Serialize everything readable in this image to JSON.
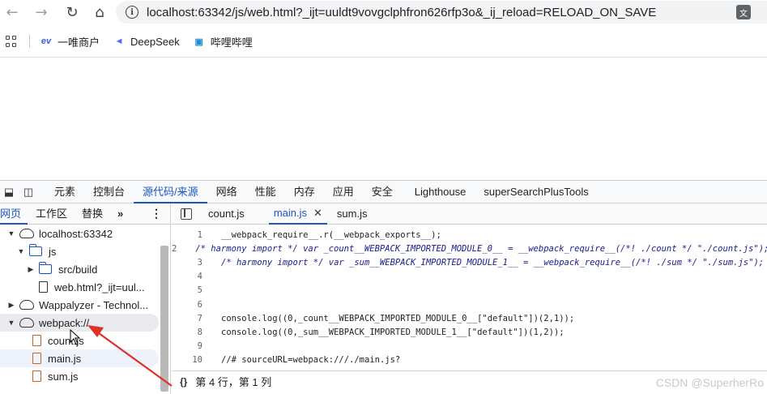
{
  "browser": {
    "url": "localhost:63342/js/web.html?_ijt=uuldt9vovgclphfron626rfp3o&_ij_reload=RELOAD_ON_SAVE",
    "bookmarks": [
      {
        "label": "一唯商户",
        "icon": "ev-logo-icon"
      },
      {
        "label": "DeepSeek",
        "icon": "deepseek-whale-icon"
      },
      {
        "label": "哔哩哔哩",
        "icon": "bilibili-tv-icon"
      }
    ]
  },
  "devtools": {
    "tabs": [
      "元素",
      "控制台",
      "源代码/来源",
      "网络",
      "性能",
      "内存",
      "应用",
      "安全",
      "Lighthouse",
      "superSearchPlusTools"
    ],
    "active_tab": "源代码/来源",
    "navigator": {
      "subtabs": [
        "网页",
        "工作区",
        "替换"
      ],
      "more": "»",
      "tree": [
        {
          "label": "localhost:63342",
          "type": "cloud",
          "caret": "▼",
          "depth": 0
        },
        {
          "label": "js",
          "type": "folder",
          "caret": "▼",
          "depth": 1
        },
        {
          "label": "src/build",
          "type": "folder",
          "caret": "▶",
          "depth": 2
        },
        {
          "label": "web.html?_ijt=uul...",
          "type": "file",
          "caret": "",
          "depth": 2
        },
        {
          "label": "Wappalyzer - Technol...",
          "type": "cloud",
          "caret": "▶",
          "depth": 0
        },
        {
          "label": "webpack://",
          "type": "cloud",
          "caret": "▼",
          "depth": 0
        },
        {
          "label": "count.js",
          "type": "jsfile",
          "caret": "",
          "depth": 1
        },
        {
          "label": "main.js",
          "type": "jsfile",
          "caret": "",
          "depth": 1
        },
        {
          "label": "sum.js",
          "type": "jsfile",
          "caret": "",
          "depth": 1
        }
      ]
    },
    "editor": {
      "open_files": [
        "count.js",
        "main.js",
        "sum.js"
      ],
      "active_file": "main.js",
      "lines": [
        {
          "n": "1",
          "text": "__webpack_require__.r(__webpack_exports__);"
        },
        {
          "n": "2",
          "text": "/* harmony import */ var _count__WEBPACK_IMPORTED_MODULE_0__ = __webpack_require__(/*! ./count */ \"./count.js\");"
        },
        {
          "n": "3",
          "text": "/* harmony import */ var _sum__WEBPACK_IMPORTED_MODULE_1__ = __webpack_require__(/*! ./sum */ \"./sum.js\");"
        },
        {
          "n": "4",
          "text": ""
        },
        {
          "n": "5",
          "text": ""
        },
        {
          "n": "6",
          "text": ""
        },
        {
          "n": "7",
          "text": "console.log((0,_count__WEBPACK_IMPORTED_MODULE_0__[\"default\"])(2,1));"
        },
        {
          "n": "8",
          "text": "console.log((0,_sum__WEBPACK_IMPORTED_MODULE_1__[\"default\"])(1,2));"
        },
        {
          "n": "9",
          "text": ""
        },
        {
          "n": "10",
          "text": "//# sourceURL=webpack:///./main.js?"
        }
      ],
      "status": "第 4 行，第 1 列"
    }
  },
  "watermark": "CSDN @SuperherRo",
  "colors": {
    "accent": "#1a56c4",
    "annotation_arrow": "#e0302a"
  }
}
